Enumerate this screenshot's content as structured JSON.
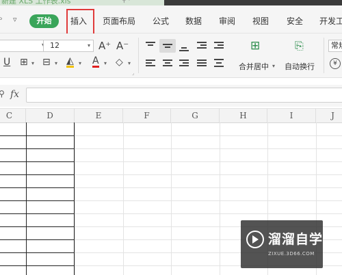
{
  "title_bar": {
    "document_title": "新建 XLS 工作表.xls"
  },
  "menu": {
    "left_symbol": "ᵓ",
    "dropdown_symbol": "▿",
    "start_tab": "开始",
    "tabs": [
      "插入",
      "页面布局",
      "公式",
      "数据",
      "审阅",
      "视图",
      "安全",
      "开发工"
    ],
    "highlighted_tab": "插入"
  },
  "ribbon": {
    "font_size": "12",
    "increase_font": "A⁺",
    "decrease_font": "A⁻",
    "merge_center_label": "合并居中",
    "auto_wrap_label": "自动换行",
    "number_format_label": "常规",
    "currency_symbol": "¥",
    "underline": "U",
    "font_color_letter": "A"
  },
  "formula_bar": {
    "fx_label": "fx",
    "value": ""
  },
  "columns": [
    "C",
    "D",
    "E",
    "F",
    "G",
    "H",
    "I",
    "J"
  ],
  "watermark": {
    "brand": "溜溜自学",
    "url": "ZIXUE.3D66.COM"
  }
}
